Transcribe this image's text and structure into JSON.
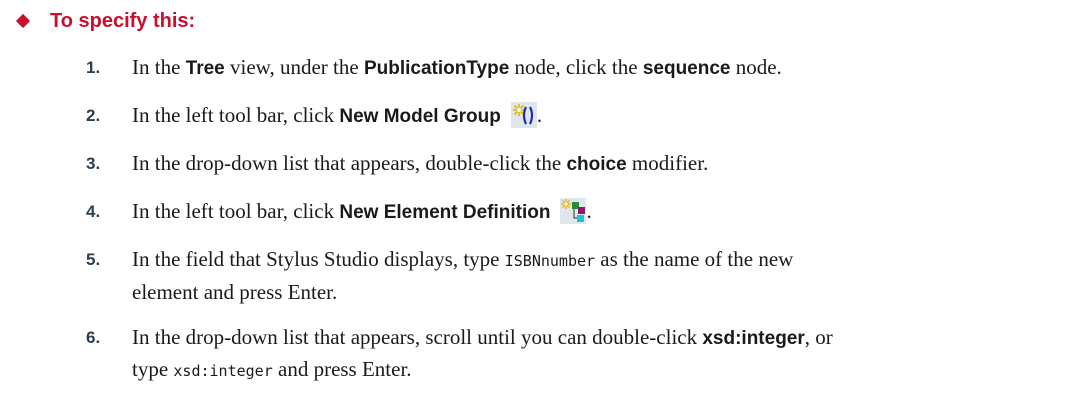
{
  "heading": {
    "text": "To specify this:"
  },
  "steps": [
    {
      "number": "1.",
      "parts": {
        "t1": "In the ",
        "b1": "Tree",
        "t2": " view, under the ",
        "b2": "PublicationType",
        "t3": " node, click the ",
        "b3": "sequence",
        "t4": " node."
      }
    },
    {
      "number": "2.",
      "parts": {
        "t1": "In the left tool bar, click ",
        "b1": "New Model Group",
        "t2": "."
      },
      "icon": "new-model-group-icon"
    },
    {
      "number": "3.",
      "parts": {
        "t1": "In the drop-down list that appears, double-click the ",
        "b1": "choice",
        "t2": " modifier."
      }
    },
    {
      "number": "4.",
      "parts": {
        "t1": "In the left tool bar, click ",
        "b1": "New Element Definition",
        "t2": "."
      },
      "icon": "new-element-definition-icon"
    },
    {
      "number": "5.",
      "parts": {
        "t1": "In the field that Stylus Studio displays, type ",
        "m1": "ISBNnumber",
        "t2": " as the name of the new",
        "t3": "element and press Enter."
      }
    },
    {
      "number": "6.",
      "parts": {
        "t1": "In the drop-down list that appears, scroll until you can double-click ",
        "b1": "xsd:integer",
        "t2": ", or",
        "t3": "type ",
        "m1": "xsd:integer",
        "t4": " and press Enter."
      }
    }
  ],
  "colors": {
    "heading": "#c8102e",
    "text": "#1a1a1a",
    "number": "#2c3e50"
  }
}
